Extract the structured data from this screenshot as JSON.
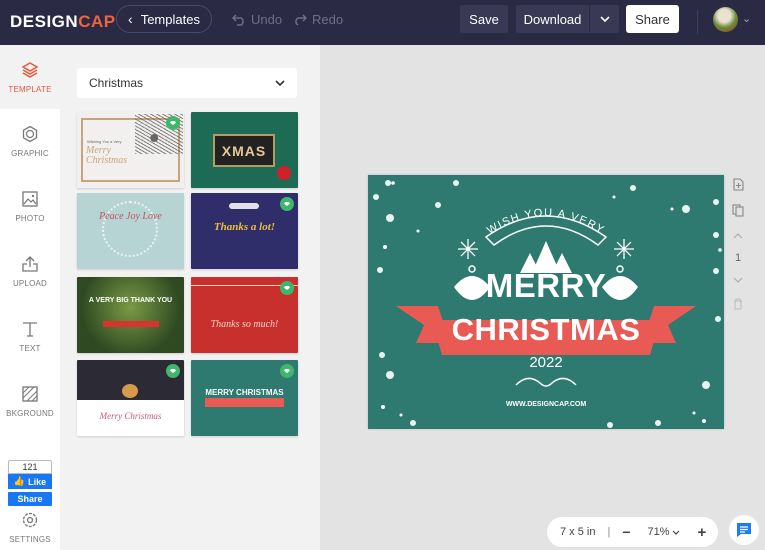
{
  "header": {
    "logo_main": "DESIGN",
    "logo_accent": "CAP",
    "back_label": "Templates",
    "undo_label": "Undo",
    "redo_label": "Redo",
    "save_label": "Save",
    "download_label": "Download",
    "share_label": "Share"
  },
  "sidebar": {
    "items": [
      {
        "label": "TEMPLATE",
        "icon": "layers-icon",
        "active": true
      },
      {
        "label": "GRAPHIC",
        "icon": "graphic-icon"
      },
      {
        "label": "PHOTO",
        "icon": "photo-icon"
      },
      {
        "label": "UPLOAD",
        "icon": "upload-icon"
      },
      {
        "label": "TEXT",
        "icon": "text-icon"
      },
      {
        "label": "BKGROUND",
        "icon": "background-icon"
      },
      {
        "label": "SETTINGS",
        "icon": "gear-icon"
      }
    ],
    "facebook": {
      "count": "121",
      "like_label": "Like",
      "share_label": "Share"
    }
  },
  "panel": {
    "category": "Christmas",
    "templates": [
      {
        "title": "Merry Christmas",
        "subtitle": "Wishing You a Very",
        "premium": true
      },
      {
        "title": "XMAS",
        "premium": false
      },
      {
        "title": "Peace Joy Love",
        "premium": false
      },
      {
        "title": "Thanks a lot!",
        "premium": true
      },
      {
        "title": "A VERY BIG THANK YOU",
        "premium": false
      },
      {
        "title": "Thanks so much!",
        "premium": true
      },
      {
        "title": "Merry Christmas",
        "premium": true
      },
      {
        "title": "MERRY CHRISTMAS",
        "premium": true
      }
    ]
  },
  "design": {
    "arc_text": "WISH YOU A VERY",
    "line1": "MERRY",
    "line2": "CHRISTMAS",
    "year": "2022",
    "website": "WWW.DESIGNCAP.COM",
    "bg_color": "#2e7a70",
    "ribbon_color": "#ea5a55"
  },
  "page_tools": {
    "page_number": "1"
  },
  "zoom_bar": {
    "size": "7 x 5 in",
    "separator": "|",
    "minus": "−",
    "zoom": "71%",
    "plus": "+"
  },
  "colors": {
    "accent": "#e8573a",
    "header_bg": "#2b2a45",
    "premium": "#3fb66b"
  }
}
